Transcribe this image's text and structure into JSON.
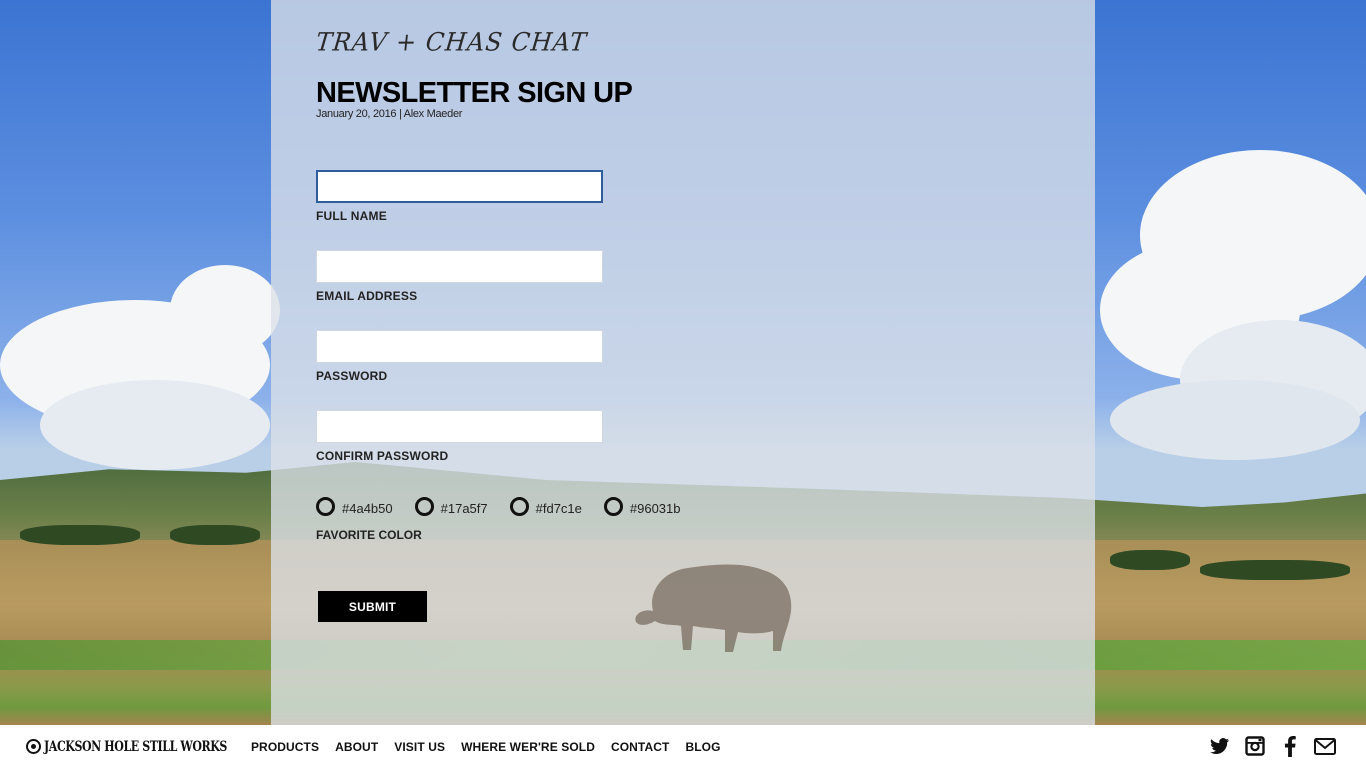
{
  "blog": {
    "title": "TRAV + CHAS CHAT"
  },
  "post": {
    "title": "NEWSLETTER SIGN UP",
    "meta": "January 20, 2016 | Alex Maeder"
  },
  "form": {
    "fields": [
      {
        "label": "FULL NAME",
        "value": "",
        "type": "text",
        "focused": true
      },
      {
        "label": "EMAIL ADDRESS",
        "value": "",
        "type": "email",
        "focused": false
      },
      {
        "label": "PASSWORD",
        "value": "",
        "type": "password",
        "focused": false
      },
      {
        "label": "CONFIRM PASSWORD",
        "value": "",
        "type": "password",
        "focused": false
      }
    ],
    "favorite_color": {
      "label": "FAVORITE COLOR",
      "options": [
        "#4a4b50",
        "#17a5f7",
        "#fd7c1e",
        "#96031b"
      ],
      "selected": null
    },
    "submit_label": "SUBMIT"
  },
  "footer": {
    "logo_text": "JACKSON HOLE STILL WORKS",
    "nav": [
      "PRODUCTS",
      "ABOUT",
      "VISIT US",
      "WHERE WER'RE SOLD",
      "CONTACT",
      "BLOG"
    ],
    "social_icons": [
      "twitter-icon",
      "instagram-icon",
      "facebook-icon",
      "email-icon"
    ]
  }
}
